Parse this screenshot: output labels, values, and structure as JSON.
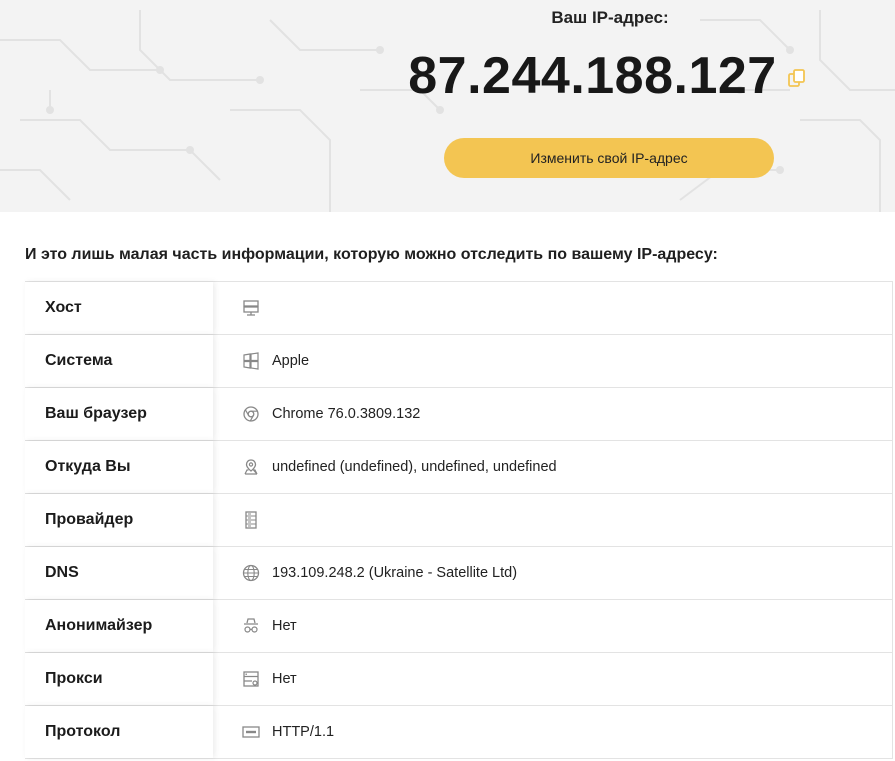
{
  "hero": {
    "label": "Ваш IP-адрес:",
    "ip": "87.244.188.127",
    "change_button": "Изменить свой IP-адрес"
  },
  "subtitle": "И это лишь малая часть информации, которую можно отследить по вашему IP-адресу:",
  "rows": [
    {
      "label": "Хост",
      "value": "",
      "icon": "server-icon"
    },
    {
      "label": "Система",
      "value": "Apple",
      "icon": "windows-icon"
    },
    {
      "label": "Ваш браузер",
      "value": "Chrome 76.0.3809.132",
      "icon": "chrome-icon"
    },
    {
      "label": "Откуда Вы",
      "value": "undefined (undefined), undefined, undefined",
      "icon": "location-pin-icon"
    },
    {
      "label": "Провайдер",
      "value": "",
      "icon": "server-rack-icon"
    },
    {
      "label": "DNS",
      "value": "193.109.248.2 (Ukraine - Satellite Ltd)",
      "icon": "globe-icon"
    },
    {
      "label": "Анонимайзер",
      "value": "Нет",
      "icon": "spy-icon"
    },
    {
      "label": "Прокси",
      "value": "Нет",
      "icon": "proxy-icon"
    },
    {
      "label": "Протокол",
      "value": "HTTP/1.1",
      "icon": "http-icon"
    }
  ],
  "colors": {
    "accent": "#f3c552",
    "hero_bg": "#f3f3f3"
  }
}
